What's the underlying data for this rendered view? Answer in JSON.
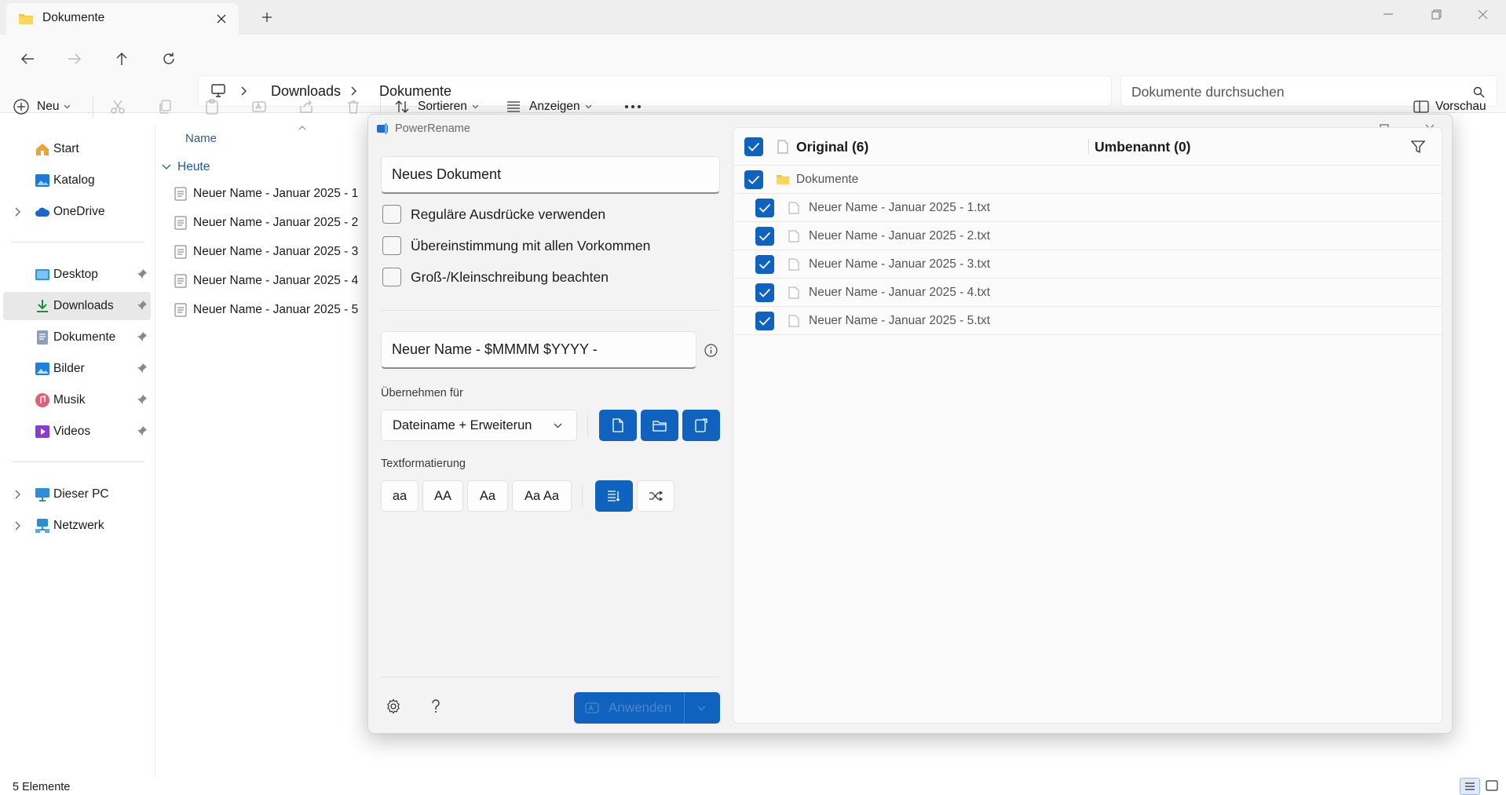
{
  "window": {
    "tab_title": "Dokumente"
  },
  "breadcrumb": [
    "Downloads",
    "Dokumente"
  ],
  "search": {
    "placeholder": "Dokumente durchsuchen"
  },
  "toolbar": {
    "new_label": "Neu",
    "sort_label": "Sortieren",
    "view_label": "Anzeigen",
    "preview_label": "Vorschau"
  },
  "sidebar": {
    "items": [
      {
        "label": "Start"
      },
      {
        "label": "Katalog"
      },
      {
        "label": "OneDrive"
      },
      {
        "label": "Desktop"
      },
      {
        "label": "Downloads"
      },
      {
        "label": "Dokumente"
      },
      {
        "label": "Bilder"
      },
      {
        "label": "Musik"
      },
      {
        "label": "Videos"
      },
      {
        "label": "Dieser PC"
      },
      {
        "label": "Netzwerk"
      }
    ]
  },
  "filelist": {
    "column_name": "Name",
    "group_label": "Heute",
    "files": [
      "Neuer Name - Januar 2025 - 1",
      "Neuer Name - Januar 2025 - 2",
      "Neuer Name - Januar 2025 - 3",
      "Neuer Name - Januar 2025 - 4",
      "Neuer Name - Januar 2025 - 5"
    ]
  },
  "status": {
    "count": "5 Elemente"
  },
  "powerrename": {
    "title": "PowerRename",
    "search_value": "Neues Dokument",
    "options": [
      {
        "label": "Reguläre Ausdrücke verwenden",
        "checked": false
      },
      {
        "label": "Übereinstimmung mit allen Vorkommen",
        "checked": false
      },
      {
        "label": "Groß-/Kleinschreibung beachten",
        "checked": false
      }
    ],
    "replace_value": "Neuer Name - $MMMM $YYYY -",
    "apply_for_label": "Übernehmen für",
    "apply_for_value": "Dateiname + Erweiterun",
    "text_format_label": "Textformatierung",
    "format_buttons": [
      "aa",
      "AA",
      "Aa",
      "Aa Aa"
    ],
    "apply_label": "Anwenden",
    "list": {
      "original_header": "Original (6)",
      "renamed_header": "Umbenannt (0)",
      "folder": "Dokumente",
      "files": [
        "Neuer Name - Januar 2025 - 1.txt",
        "Neuer Name - Januar 2025 - 2.txt",
        "Neuer Name - Januar 2025 - 3.txt",
        "Neuer Name - Januar 2025 - 4.txt",
        "Neuer Name - Januar 2025 - 5.txt"
      ]
    }
  },
  "colors": {
    "accent": "#0f62be",
    "folder": "#f4c542"
  }
}
